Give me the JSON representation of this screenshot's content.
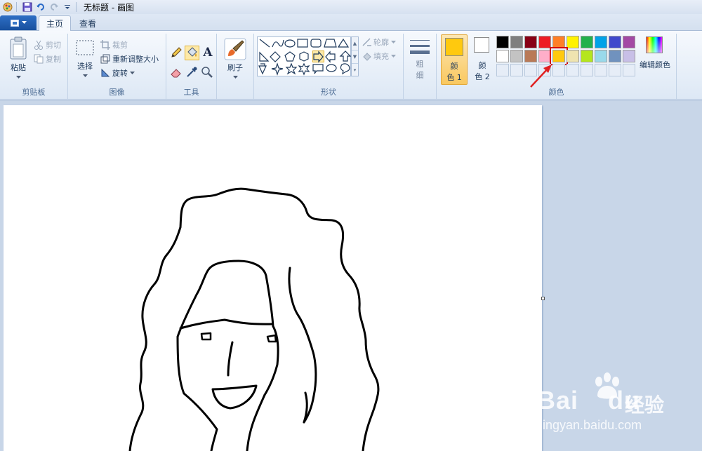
{
  "title_bar": {
    "title": "无标题 - 画图"
  },
  "tabs": [
    {
      "label": "主页"
    },
    {
      "label": "查看"
    }
  ],
  "clipboard": {
    "paste": "粘贴",
    "cut": "剪切",
    "copy": "复制",
    "group": "剪贴板"
  },
  "image": {
    "select": "选择",
    "crop": "裁剪",
    "resize": "重新调整大小",
    "rotate": "旋转",
    "group": "图像"
  },
  "tools": {
    "group": "工具",
    "text_tool": "A"
  },
  "brushes": {
    "label": "刷子"
  },
  "shapes": {
    "outline": "轮廓",
    "fill": "填充",
    "group": "形状"
  },
  "size": {
    "label_top": "粗",
    "label_bottom": "细"
  },
  "colors": {
    "color1_top": "颜",
    "color1_bottom": "色 1",
    "color2_top": "颜",
    "color2_bottom": "色 2",
    "color1_value": "#ffc90e",
    "edit": "编辑颜色",
    "group": "颜色",
    "palette_row1": [
      "#000000",
      "#7f7f7f",
      "#880015",
      "#ed1c24",
      "#ff7f27",
      "#fff200",
      "#22b14c",
      "#00a2e8",
      "#3f48cc",
      "#a349a4"
    ],
    "palette_row2": [
      "#ffffff",
      "#c3c3c3",
      "#b97a57",
      "#ffaec9",
      "#ffc90e",
      "#efe4b0",
      "#b5e61d",
      "#99d9ea",
      "#7092be",
      "#c8bfe7"
    ],
    "selected": "#ffc90e"
  },
  "watermark": {
    "brand": "Bai",
    "brand2": "du",
    "cn": "经验",
    "url": "jingyan.baidu.com"
  }
}
